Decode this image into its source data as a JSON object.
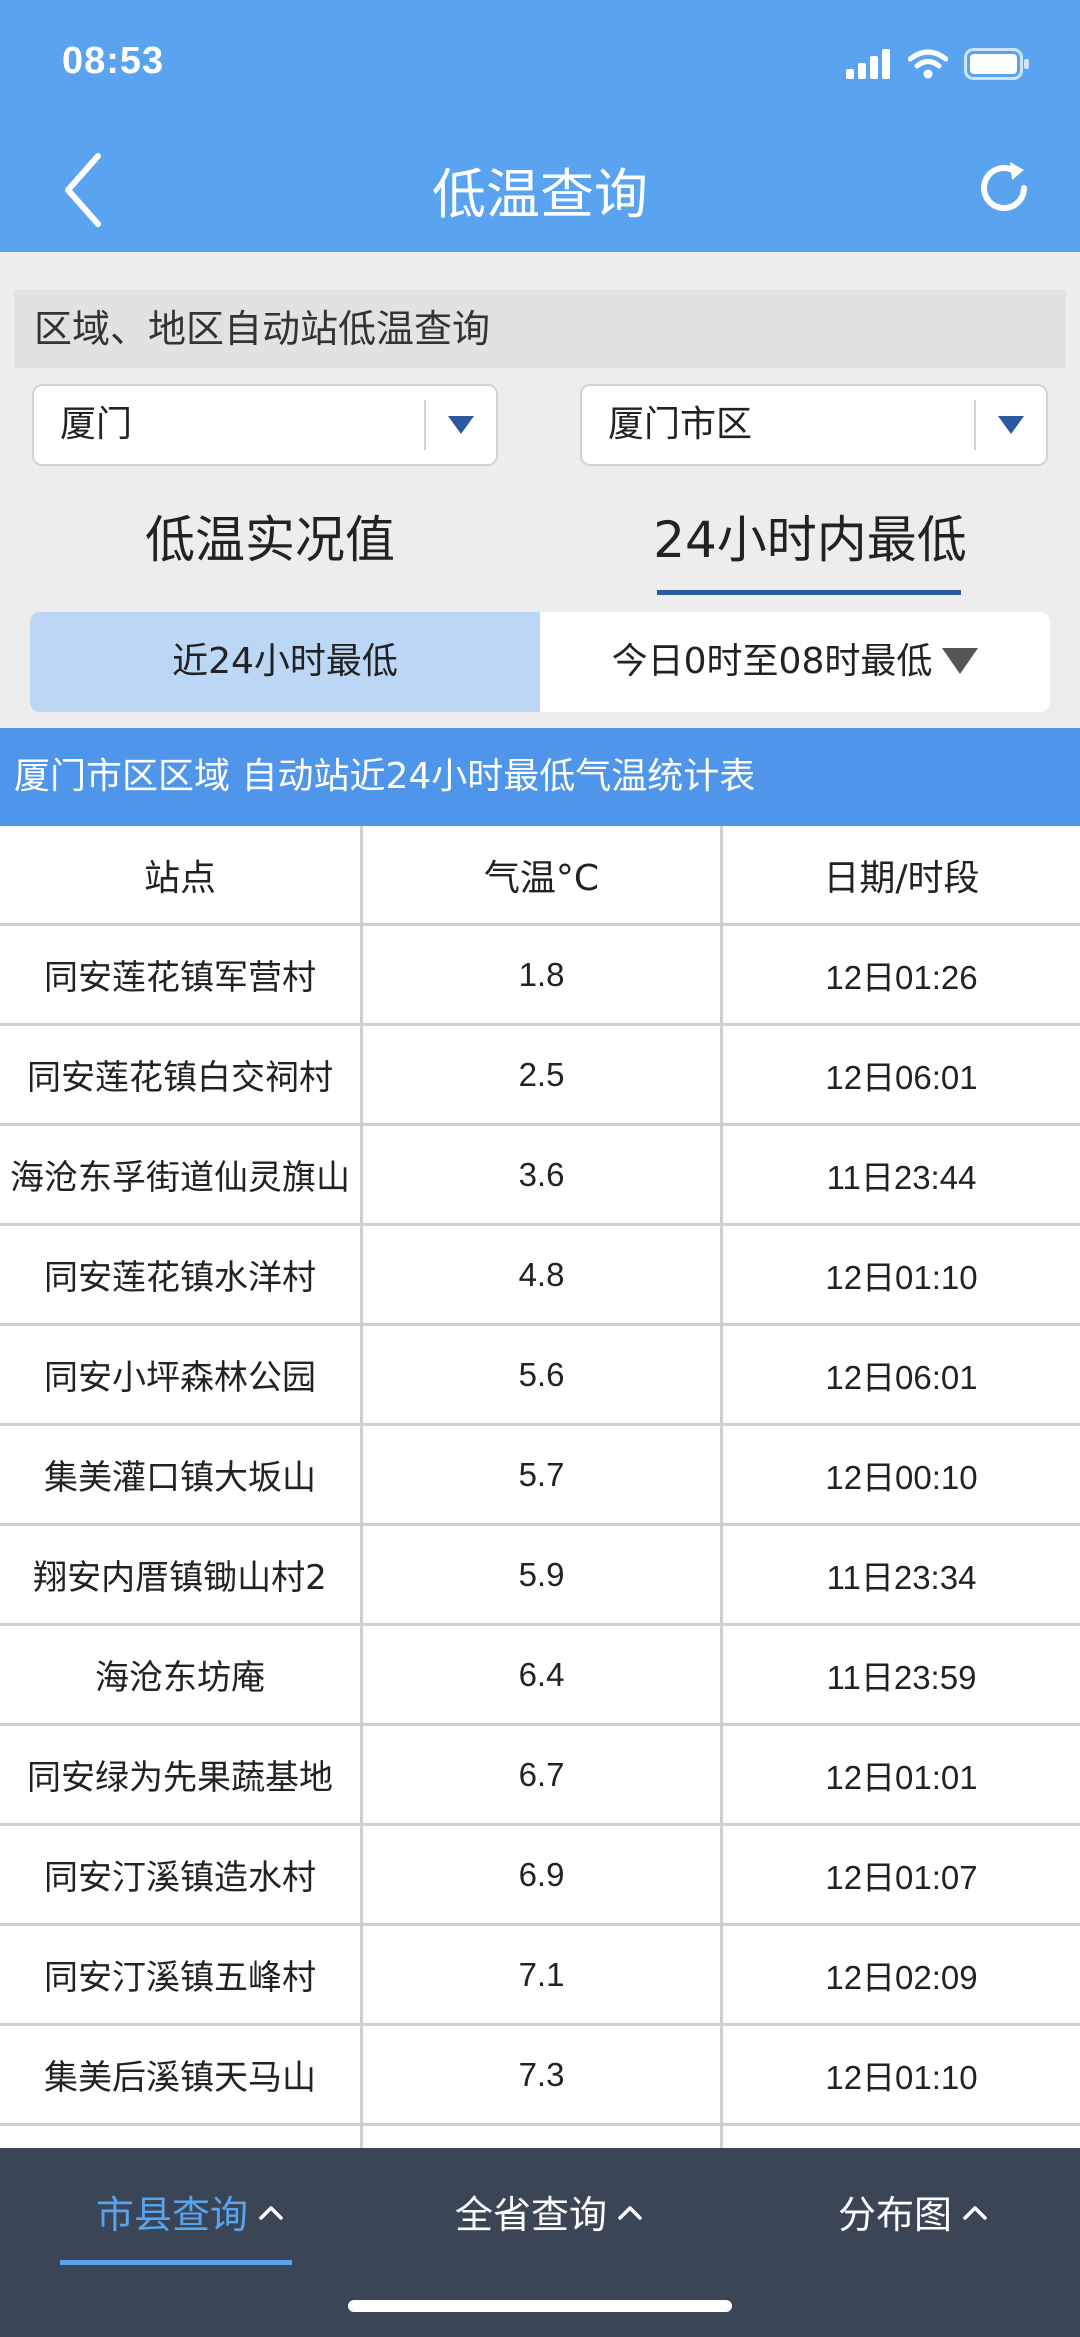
{
  "status": {
    "time": "08:53"
  },
  "nav": {
    "title": "低温查询"
  },
  "query": {
    "title": "区域、地区自动站低温查询",
    "city": "厦门",
    "district": "厦门市区"
  },
  "tabs": [
    {
      "label": "低温实况值",
      "active": false
    },
    {
      "label": "24小时内最低",
      "active": true
    }
  ],
  "segments": [
    {
      "label": "近24小时最低",
      "active": true
    },
    {
      "label": "今日0时至08时最低",
      "active": false
    }
  ],
  "table": {
    "title": "厦门市区区域 自动站近24小时最低气温统计表",
    "headers": [
      "站点",
      "气温°C",
      "日期/时段"
    ],
    "rows": [
      [
        "同安莲花镇军营村",
        "1.8",
        "12日01:26"
      ],
      [
        "同安莲花镇白交祠村",
        "2.5",
        "12日06:01"
      ],
      [
        "海沧东孚街道仙灵旗山",
        "3.6",
        "11日23:44"
      ],
      [
        "同安莲花镇水洋村",
        "4.8",
        "12日01:10"
      ],
      [
        "同安小坪森林公园",
        "5.6",
        "12日06:01"
      ],
      [
        "集美灌口镇大坂山",
        "5.7",
        "12日00:10"
      ],
      [
        "翔安内厝镇锄山村2",
        "5.9",
        "11日23:34"
      ],
      [
        "海沧东坊庵",
        "6.4",
        "11日23:59"
      ],
      [
        "同安绿为先果蔬基地",
        "6.7",
        "12日01:01"
      ],
      [
        "同安汀溪镇造水村",
        "6.9",
        "12日01:07"
      ],
      [
        "同安汀溪镇五峰村",
        "7.1",
        "12日02:09"
      ],
      [
        "集美后溪镇天马山",
        "7.3",
        "12日01:10"
      ]
    ]
  },
  "bottom_nav": [
    {
      "label": "市县查询",
      "active": true
    },
    {
      "label": "全省查询",
      "active": false
    },
    {
      "label": "分布图",
      "active": false
    }
  ],
  "colors": {
    "header": "#5aa3f0",
    "table_title": "#4f96ea",
    "accent": "#2c5aa0",
    "bottom_bar": "#3a4656"
  }
}
